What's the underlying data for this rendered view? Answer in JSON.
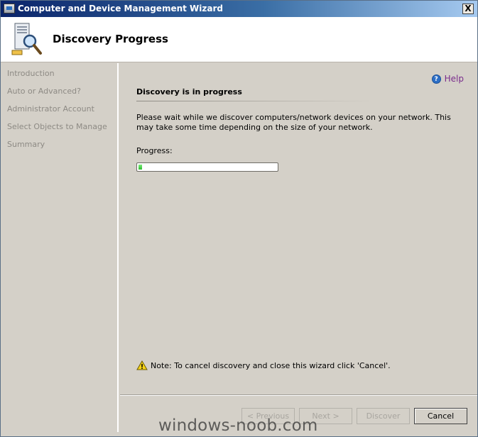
{
  "window": {
    "title": "Computer and Device Management Wizard",
    "close_glyph": "X"
  },
  "header": {
    "title": "Discovery Progress",
    "icon": "computer-search-icon"
  },
  "nav": {
    "items": [
      {
        "label": "Introduction"
      },
      {
        "label": "Auto or Advanced?"
      },
      {
        "label": "Administrator Account"
      },
      {
        "label": "Select Objects to Manage"
      },
      {
        "label": "Summary"
      }
    ]
  },
  "help": {
    "label": "Help",
    "icon": "help-icon"
  },
  "main": {
    "section_title": "Discovery is in progress",
    "description": "Please wait while we discover computers/network devices on your network. This may take some time depending on the size of your network.",
    "progress_label": "Progress:",
    "progress_fraction": 0.025,
    "note_text": "Note: To cancel discovery and close this wizard click 'Cancel'.",
    "note_icon": "warning-icon"
  },
  "footer": {
    "previous_label": "< Previous",
    "next_label": "Next >",
    "discover_label": "Discover",
    "cancel_label": "Cancel"
  },
  "watermark": "windows-noob.com",
  "colors": {
    "title_bar": "#0a246a",
    "help_link": "#7a2c8c",
    "progress_green": "#2fbf2f"
  }
}
